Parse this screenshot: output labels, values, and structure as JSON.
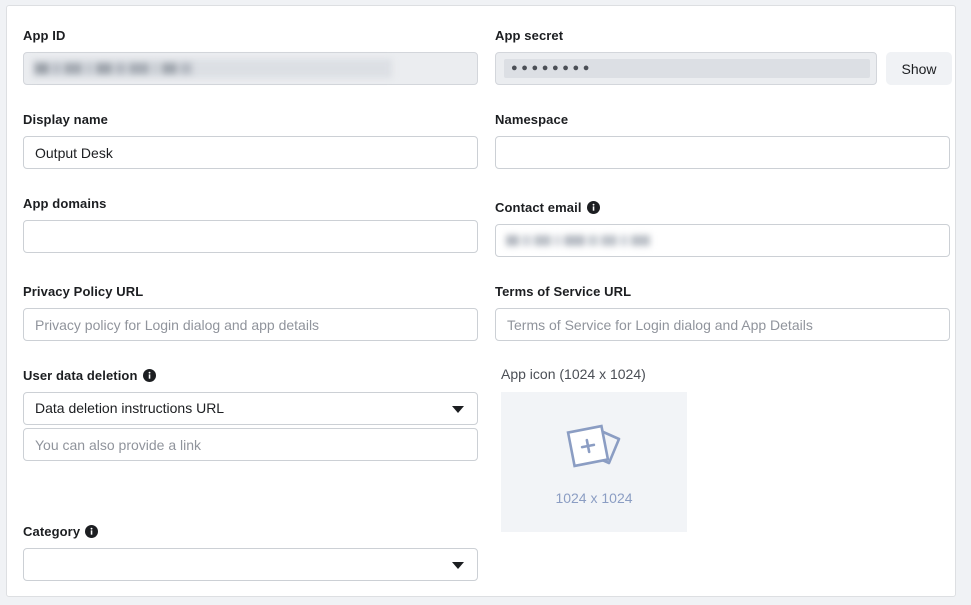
{
  "page": {
    "background_color": "#f0f2f5",
    "card_background": "#ffffff",
    "accent_color": "#8b9dc3"
  },
  "left_column": {
    "app_id": {
      "label": "App ID",
      "value": "",
      "redacted": true,
      "disabled": true
    },
    "display_name": {
      "label": "Display name",
      "value": "Output Desk",
      "placeholder": ""
    },
    "app_domains": {
      "label": "App domains",
      "value": "",
      "placeholder": ""
    },
    "privacy_policy_url": {
      "label": "Privacy Policy URL",
      "value": "",
      "placeholder": "Privacy policy for Login dialog and app details"
    },
    "user_data_deletion": {
      "label": "User data deletion",
      "has_info_icon": true,
      "selected_option": "Data deletion instructions URL",
      "link_value": "",
      "link_placeholder": "You can also provide a link"
    },
    "category": {
      "label": "Category",
      "has_info_icon": true,
      "selected_option": ""
    }
  },
  "right_column": {
    "app_secret": {
      "label": "App secret",
      "masked_value": "●●●●●●●●",
      "disabled": true,
      "show_button_label": "Show"
    },
    "namespace": {
      "label": "Namespace",
      "value": "",
      "placeholder": ""
    },
    "contact_email": {
      "label": "Contact email",
      "has_info_icon": true,
      "value": "",
      "redacted": true
    },
    "terms_of_service_url": {
      "label": "Terms of Service URL",
      "value": "",
      "placeholder": "Terms of Service for Login dialog and App Details"
    },
    "app_icon": {
      "label": "App icon (1024 x 1024)",
      "uploader_caption": "1024 x 1024",
      "uploader_icon": "add-photo-icon"
    }
  }
}
